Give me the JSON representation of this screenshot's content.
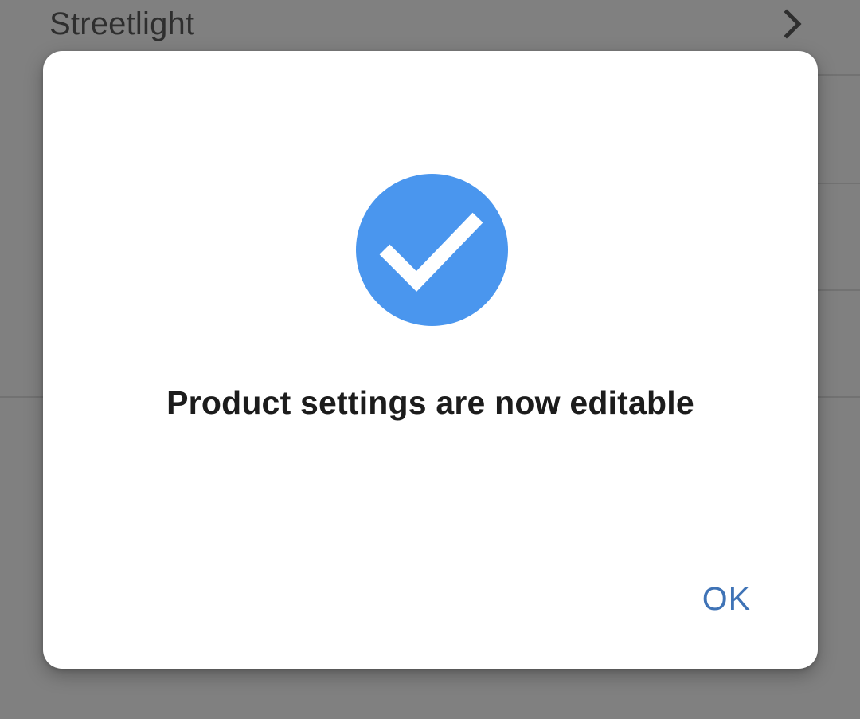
{
  "background": {
    "list_item_label": "Streetlight",
    "chevron_icon": "chevron-right-icon",
    "scrim_color": "#808080"
  },
  "dialog": {
    "icon": "check-circle-icon",
    "icon_color": "#4a96ee",
    "message": "Product settings are now editable",
    "ok_label": "OK",
    "accent_color": "#3f73b6"
  }
}
